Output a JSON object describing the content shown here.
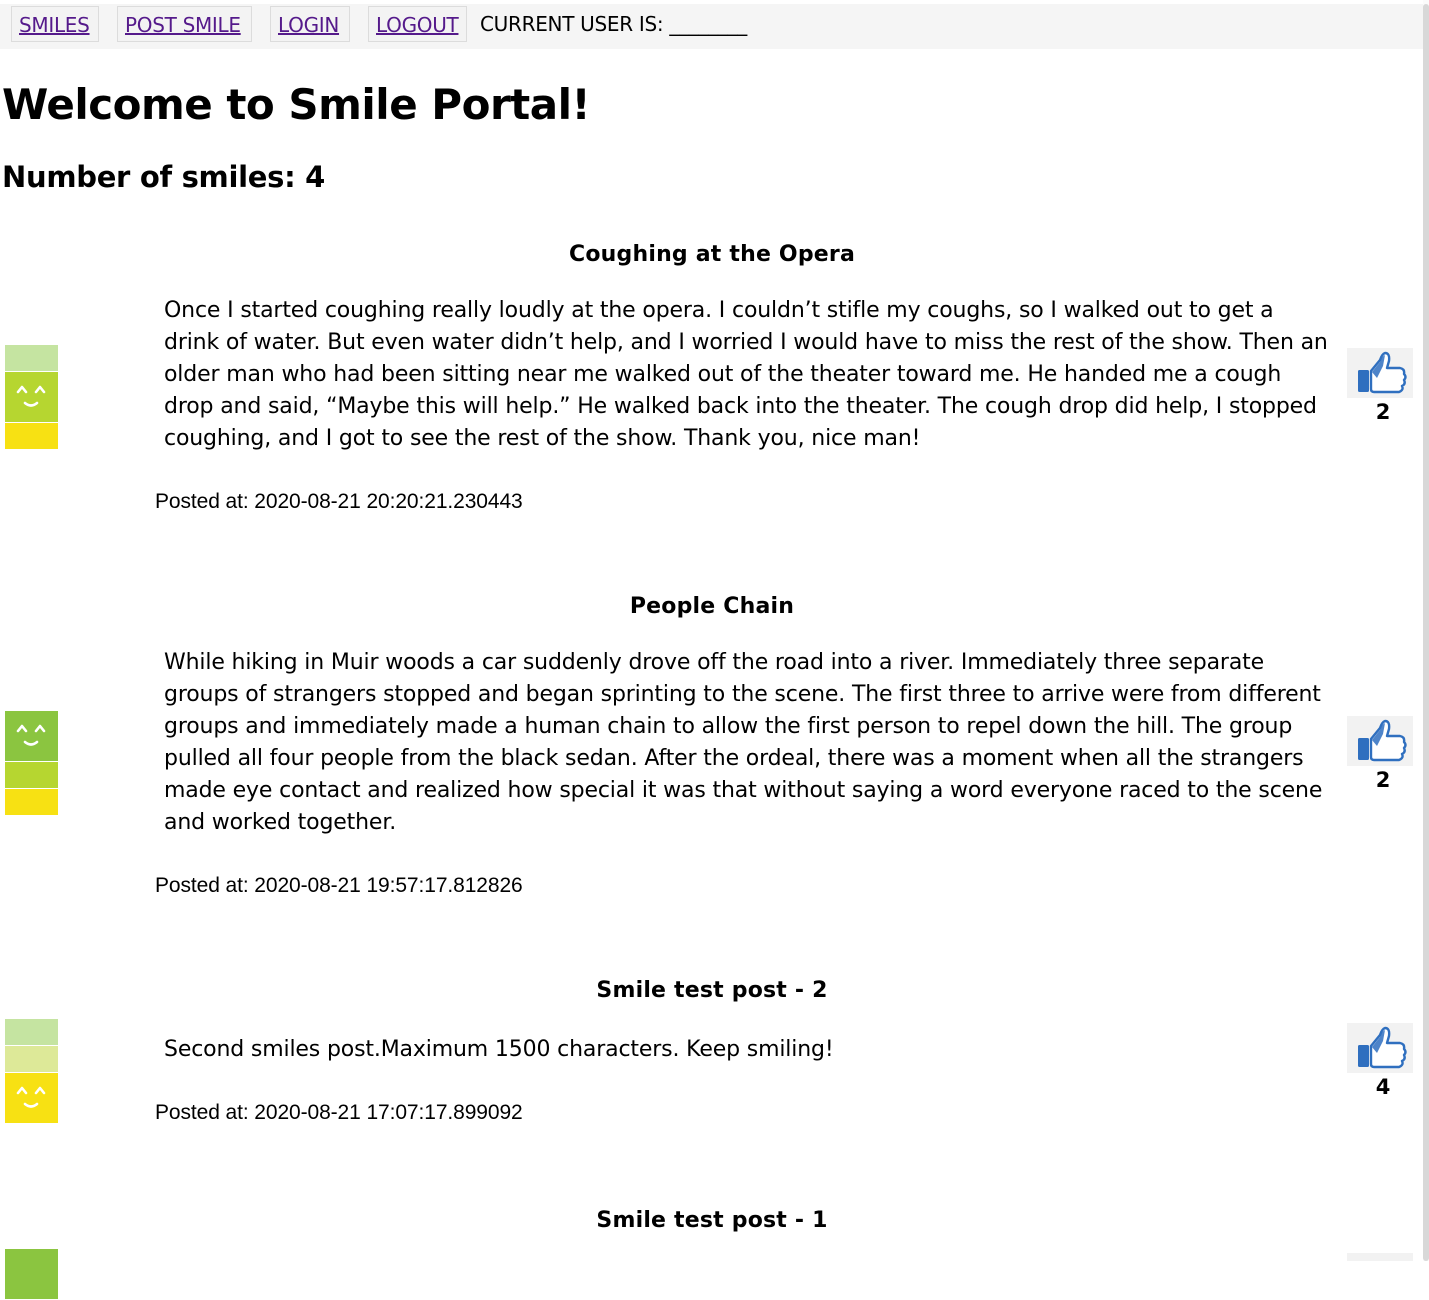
{
  "nav": {
    "smiles": "SMILES",
    "post_smile": "POST SMILE",
    "login": "LOGIN",
    "logout": "LOGOUT",
    "current_user_label": "CURRENT USER IS: ________"
  },
  "page": {
    "title": "Welcome to Smile Portal!",
    "count_label": "Number of smiles: 4"
  },
  "posts": [
    {
      "title": "Coughing at the Opera",
      "body": "Once I started coughing really loudly at the opera. I couldn’t stifle my coughs, so I walked out to get a drink of water. But even water didn’t help, and I worried I would have to miss the rest of the show. Then an older man who had been sitting near me walked out of the theater toward me. He handed me a cough drop and said, “Maybe this will help.” He walked back into the theater. The cough drop did help, I stopped coughing, and I got to see the rest of the show. Thank you, nice man!",
      "posted_at": "Posted at: 2020-08-21 20:20:21.230443",
      "likes": "2",
      "mood_level": "middle"
    },
    {
      "title": "People Chain",
      "body": "While hiking in Muir woods a car suddenly drove off the road into a river. Immediately three separate groups of strangers stopped and began sprinting to the scene. The first three to arrive were from different groups and immediately made a human chain to allow the first person to repel down the hill. The group pulled all four people from the black sedan. After the ordeal, there was a moment when all the strangers made eye contact and realized how special it was that without saying a word everyone raced to the scene and worked together.",
      "posted_at": "Posted at: 2020-08-21 19:57:17.812826",
      "likes": "2",
      "mood_level": "top"
    },
    {
      "title": "Smile test post - 2",
      "body": "Second smiles post.Maximum 1500 characters. Keep smiling!",
      "posted_at": "Posted at: 2020-08-21 17:07:17.899092",
      "likes": "4",
      "mood_level": "bottom"
    },
    {
      "title": "Smile test post - 1",
      "mood_level": "top"
    }
  ],
  "colors": {
    "link": "#551a8b",
    "like_blue": "#2f6fbf",
    "mood_green": "#8bc540",
    "mood_lime": "#b6d630",
    "mood_yellow": "#f7e113"
  },
  "icons": {
    "like": "thumbs-up-icon",
    "mood": "smiley-face-icon"
  }
}
